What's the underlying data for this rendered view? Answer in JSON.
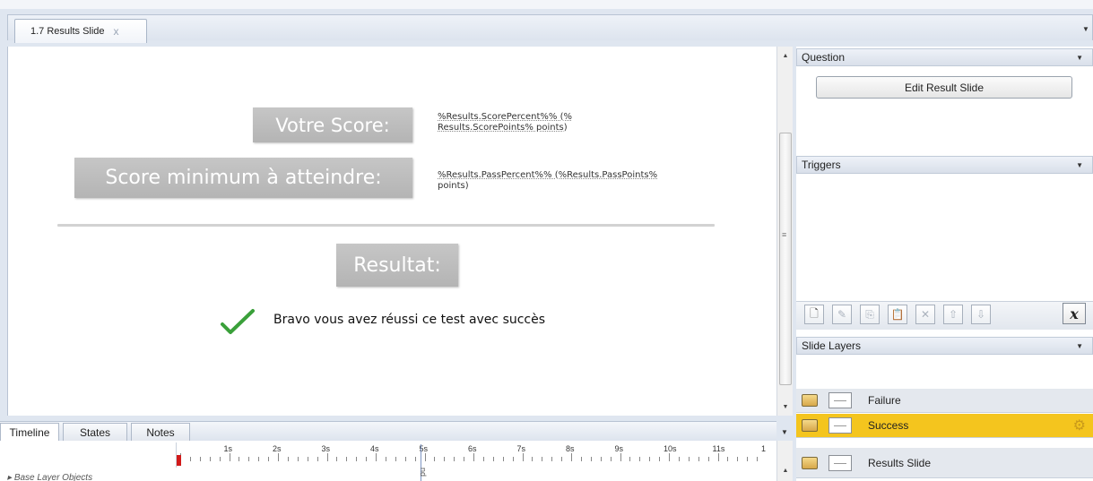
{
  "tab": {
    "title": "1.7 Results Slide",
    "close": "x"
  },
  "slide": {
    "score_label": "Votre Score:",
    "score_value_line1": "%Results.ScorePercent%% (%",
    "score_value_line2": "Results.ScorePoints% points)",
    "min_label": "Score minimum à atteindre:",
    "min_value_line1": "%Results.PassPercent%% (%Results.PassPoints%",
    "min_value_line2": "points)",
    "result_label": "Resultat:",
    "success_message": "Bravo vous avez réussi ce test avec succès"
  },
  "timeline": {
    "tabs": [
      "Timeline",
      "States",
      "Notes"
    ],
    "active_tab": "Timeline",
    "ruler_labels": [
      "1s",
      "2s",
      "3s",
      "4s",
      "5s",
      "6s",
      "7s",
      "8s",
      "9s",
      "10s",
      "11s",
      "1"
    ],
    "end_marker": "nd",
    "base_layer": "Base Layer Objects"
  },
  "panels": {
    "question": {
      "title": "Question",
      "button": "Edit Result Slide"
    },
    "triggers": {
      "title": "Triggers"
    },
    "slide_layers": {
      "title": "Slide Layers",
      "layers": [
        {
          "name": "Failure"
        },
        {
          "name": "Success",
          "selected": true
        },
        {
          "name": "Results Slide"
        }
      ]
    }
  },
  "trigger_toolbar": {
    "variables_button": "x"
  },
  "colors": {
    "selected_layer": "#f4c51e",
    "check": "#3aa03a",
    "playhead": "#d11a1a"
  }
}
